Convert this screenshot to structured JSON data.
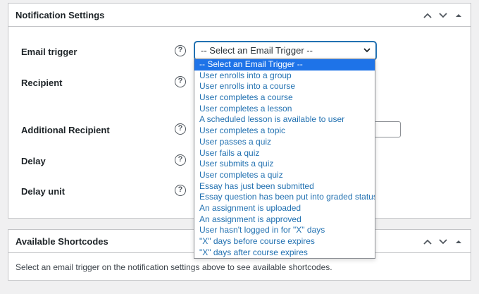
{
  "notification_settings": {
    "title": "Notification Settings",
    "fields": [
      {
        "label": "Email trigger"
      },
      {
        "label": "Recipient"
      },
      {
        "label": "Additional Recipient"
      },
      {
        "label": "Delay"
      },
      {
        "label": "Delay unit"
      }
    ],
    "help_glyph": "?",
    "email_trigger_select": {
      "value": "-- Select an Email Trigger --",
      "options": [
        "-- Select an Email Trigger --",
        "User enrolls into a group",
        "User enrolls into a course",
        "User completes a course",
        "User completes a lesson",
        "A scheduled lesson is available to user",
        "User completes a topic",
        "User passes a quiz",
        "User fails a quiz",
        "User submits a quiz",
        "User completes a quiz",
        "Essay has just been submitted",
        "Essay question has been put into graded status",
        "An assignment is uploaded",
        "An assignment is approved",
        "User hasn't logged in for \"X\" days",
        "\"X\" days before course expires",
        "\"X\" days after course expires"
      ]
    }
  },
  "available_shortcodes": {
    "title": "Available Shortcodes",
    "description": "Select an email trigger on the notification settings above to see available shortcodes."
  },
  "icons": {
    "move_up": "chevron-up-icon",
    "move_down": "chevron-down-icon",
    "toggle": "triangle-up-icon",
    "help": "help-circle-icon",
    "select_caret": "chevron-down-icon"
  },
  "colors": {
    "accent": "#2271b1",
    "selected_option_bg": "#1e73e8",
    "page_bg": "#f0f0f1",
    "border": "#c3c4c7"
  }
}
